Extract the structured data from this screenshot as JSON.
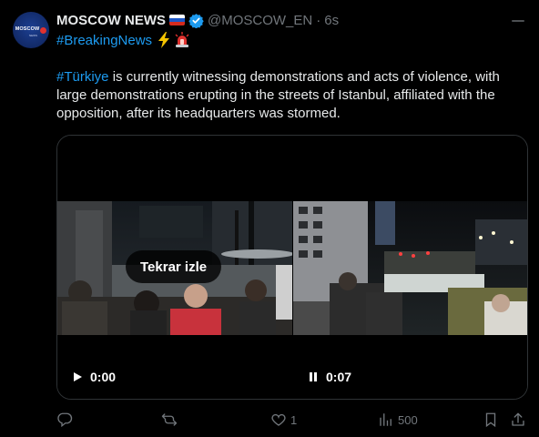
{
  "tweet": {
    "author_name": "MOSCOW NEWS",
    "handle": "@MOSCOW_EN",
    "separator": "·",
    "time": "6s",
    "hashtag_line": "#BreakingNews",
    "body_hashtag": "#Türkiye",
    "body_text": " is currently witnessing demonstrations and acts of violence, with large demonstrations erupting in the streets of Istanbul, affiliated with the opposition, after its headquarters was stormed."
  },
  "avatar": {
    "logo_text": "MOSCOW",
    "logo_sub": "NEWS"
  },
  "media": {
    "videos": [
      {
        "replay_label": "Tekrar izle",
        "state_icon": "play-icon",
        "time": "0:00"
      },
      {
        "state_icon": "pause-icon",
        "time": "0:07"
      }
    ]
  },
  "actions": {
    "reply_count": "",
    "retweet_count": "",
    "like_count": "1",
    "views_count": "500"
  },
  "colors": {
    "background": "#000000",
    "text": "#e7e9ea",
    "muted": "#71767b",
    "link": "#1d9bf0",
    "verified": "#1d9bf0",
    "border": "#2f3336"
  }
}
